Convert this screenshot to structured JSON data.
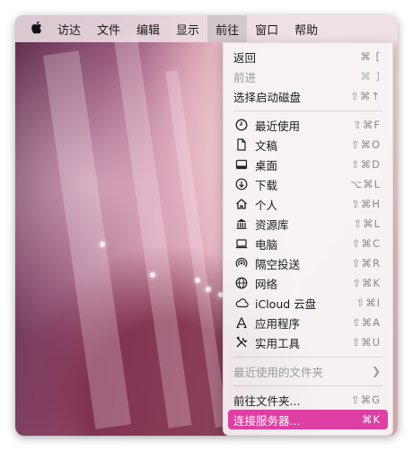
{
  "menubar": {
    "apple_icon": "apple-logo-icon",
    "items": [
      "访达",
      "文件",
      "编辑",
      "显示",
      "前往",
      "窗口",
      "帮助"
    ],
    "active_index": 4
  },
  "go_menu": {
    "items": [
      {
        "label": "返回",
        "shortcut": "⌘ [",
        "enabled": true
      },
      {
        "label": "前进",
        "shortcut": "⌘ ]",
        "enabled": false
      },
      {
        "label": "选择启动磁盘",
        "shortcut": "⇧⌘↑",
        "enabled": true
      },
      {
        "label": "最近使用",
        "shortcut": "⇧⌘F",
        "icon": "clock-icon"
      },
      {
        "label": "文稿",
        "shortcut": "⇧⌘O",
        "icon": "document-icon"
      },
      {
        "label": "桌面",
        "shortcut": "⇧⌘D",
        "icon": "desktop-icon"
      },
      {
        "label": "下载",
        "shortcut": "⌥⌘L",
        "icon": "download-icon"
      },
      {
        "label": "个人",
        "shortcut": "⇧⌘H",
        "icon": "home-icon"
      },
      {
        "label": "资源库",
        "shortcut": "⇧⌘L",
        "icon": "library-icon"
      },
      {
        "label": "电脑",
        "shortcut": "⇧⌘C",
        "icon": "computer-icon"
      },
      {
        "label": "隔空投送",
        "shortcut": "⇧⌘R",
        "icon": "airdrop-icon"
      },
      {
        "label": "网络",
        "shortcut": "⇧⌘K",
        "icon": "network-icon"
      },
      {
        "label": "iCloud 云盘",
        "shortcut": "⇧⌘I",
        "icon": "icloud-icon"
      },
      {
        "label": "应用程序",
        "shortcut": "⇧⌘A",
        "icon": "applications-icon"
      },
      {
        "label": "实用工具",
        "shortcut": "⇧⌘U",
        "icon": "utilities-icon"
      },
      {
        "label": "最近使用的文件夹",
        "enabled": false,
        "submenu": true
      },
      {
        "label": "前往文件夹...",
        "shortcut": "⇧⌘G"
      },
      {
        "label": "连接服务器...",
        "shortcut": "⌘K",
        "highlighted": true
      }
    ]
  },
  "colors": {
    "highlight": "#de3fa2",
    "menu_bg": "#f6f4f5"
  }
}
